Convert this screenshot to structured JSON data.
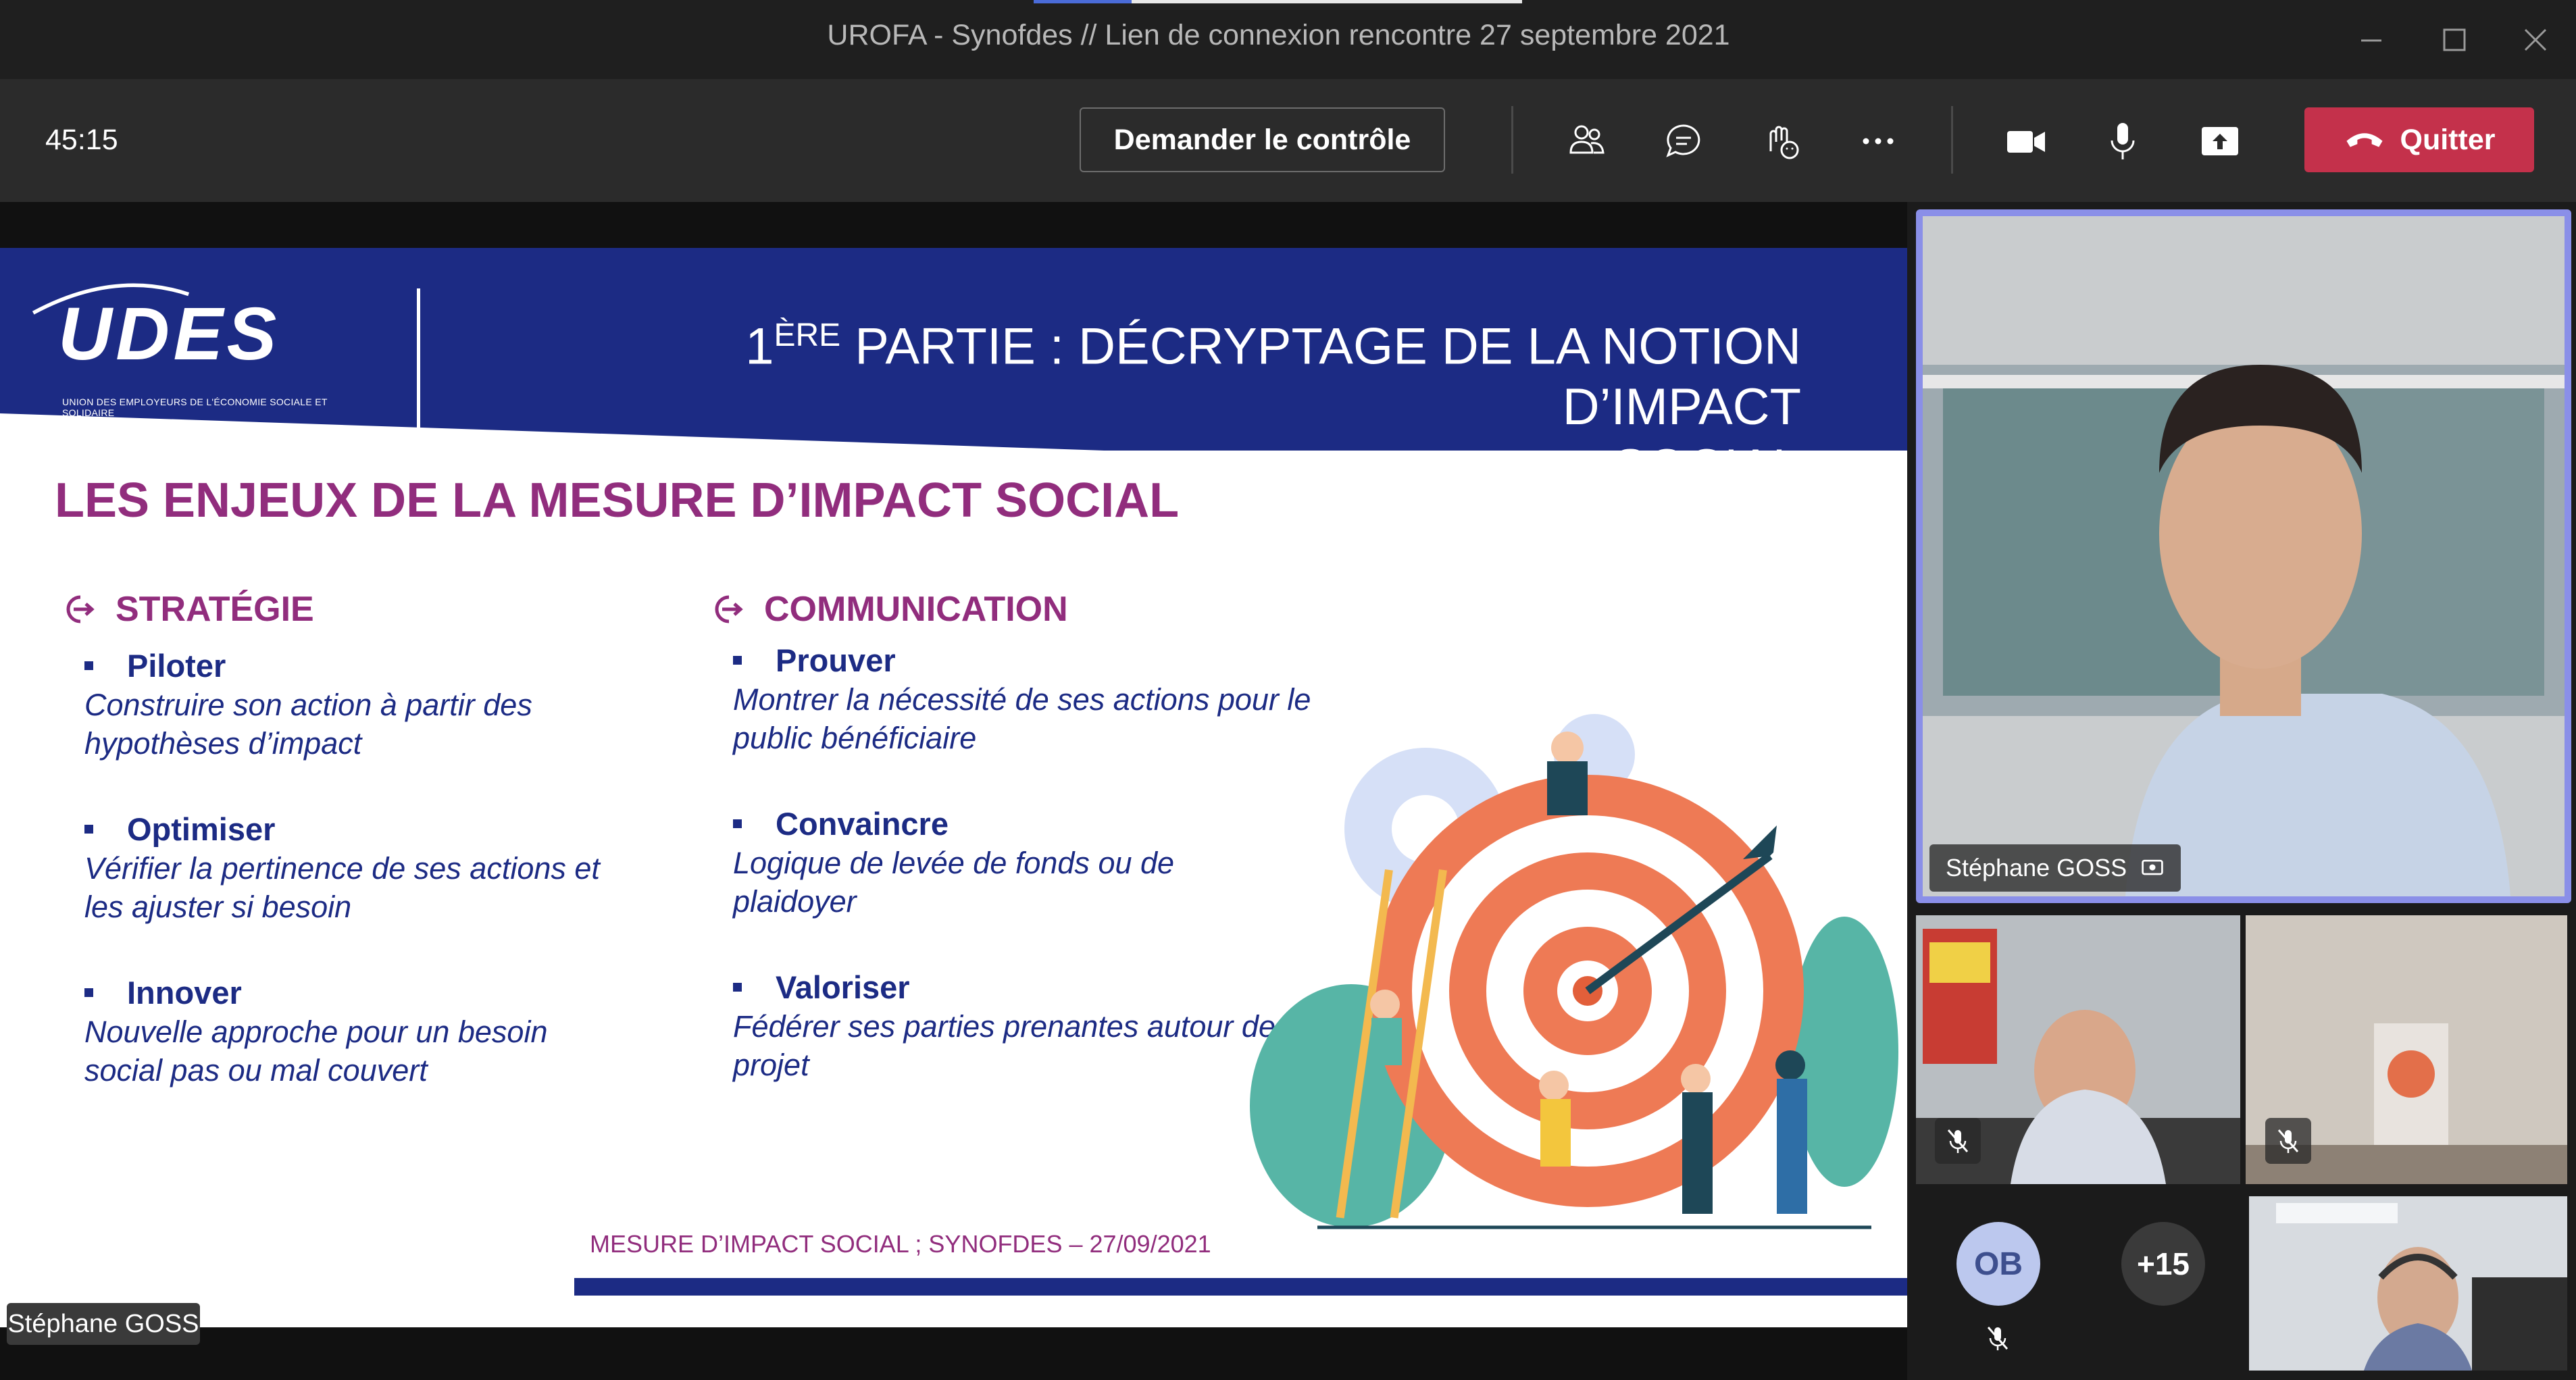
{
  "window": {
    "title": "UROFA - Synofdes // Lien de connexion rencontre 27 septembre 2021",
    "minimize_icon": "minimize-icon",
    "maximize_icon": "maximize-icon",
    "close_icon": "close-icon"
  },
  "toolbar": {
    "timer": "45:15",
    "request_control": "Demander le contrôle",
    "quit": "Quitter",
    "icons": [
      "people-icon",
      "chat-icon",
      "reactions-icon",
      "more-icon",
      "camera-icon",
      "microphone-icon",
      "share-icon",
      "hangup-icon"
    ]
  },
  "slide": {
    "logo_text": "UDES",
    "logo_subtitle": "UNION DES EMPLOYEURS DE L'ÉCONOMIE SOCIALE ET SOLIDAIRE",
    "title_prefix": "1",
    "title_sup": "ÈRE",
    "title_line1": " PARTIE : DÉCRYPTAGE DE LA NOTION D’IMPACT",
    "title_line2": "SOCIAL",
    "heading": "LES ENJEUX DE LA MESURE D’IMPACT SOCIAL",
    "strategie": {
      "title": "STRATÉGIE",
      "items": [
        {
          "head": "Piloter",
          "desc": "Construire son action à partir des hypothèses d’impact"
        },
        {
          "head": "Optimiser",
          "desc": "Vérifier la pertinence de ses actions et les ajuster si besoin"
        },
        {
          "head": "Innover",
          "desc": "Nouvelle approche pour un besoin social pas ou mal couvert"
        }
      ]
    },
    "communication": {
      "title": "COMMUNICATION",
      "items": [
        {
          "head": "Prouver",
          "desc": "Montrer la nécessité de ses actions pour le public bénéficiaire"
        },
        {
          "head": "Convaincre",
          "desc": "Logique de levée de fonds ou de plaidoyer"
        },
        {
          "head": "Valoriser",
          "desc": "Fédérer ses parties prenantes autour de son projet"
        }
      ]
    },
    "footer": "MESURE D’IMPACT SOCIAL ; SYNOFDES – 27/09/2021",
    "colors": {
      "navy": "#1c2b84",
      "magenta": "#912d7d",
      "orange": "#ee7a55"
    }
  },
  "presenter_label": "Stéphane GOSS",
  "gallery": {
    "main_speaker": "Stéphane GOSS",
    "avatar_initials": "OB",
    "more_participants": "+15",
    "highlight_color": "#8a8fe8"
  }
}
